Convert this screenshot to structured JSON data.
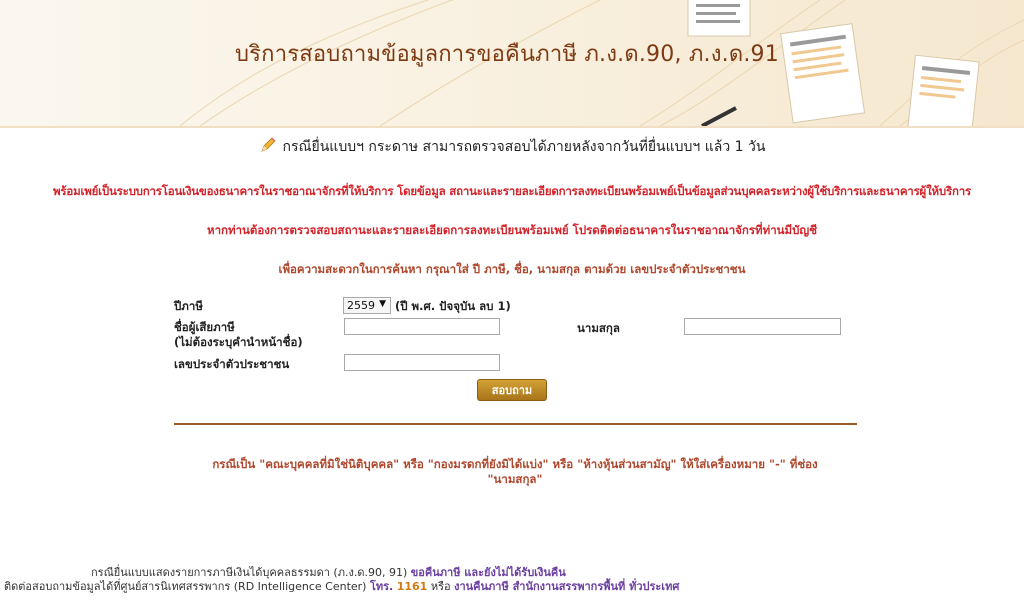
{
  "header": {
    "title": "บริการสอบถามข้อมูลการขอคืนภาษี ภ.ง.ด.90, ภ.ง.ด.91"
  },
  "notice": {
    "text": "กรณียื่นแบบฯ กระดาษ สามารถตรวจสอบได้ภายหลังจากวันที่ยื่นแบบฯ แล้ว 1 วัน"
  },
  "messages": {
    "promptpay_info": "พร้อมเพย์เป็นระบบการโอนเงินของธนาคารในราชอาณาจักรที่ให้บริการ โดยข้อมูล สถานะและรายละเอียดการลงทะเบียนพร้อมเพย์เป็นข้อมูลส่วนบุคคลระหว่างผู้ใช้บริการและธนาคารผู้ให้บริการ",
    "promptpay_contact": "หากท่านต้องการตรวจสอบสถานะและรายละเอียดการลงทะเบียนพร้อมเพย์ โปรดติดต่อธนาคารในราชอาณาจักรที่ท่านมีบัญชี",
    "search_hint": "เพื่อความสะดวกในการค้นหา กรุณาใส่ ปี ภาษี, ชื่อ, นามสกุล ตามด้วย เลขประจำตัวประชาชน"
  },
  "form": {
    "tax_year_label": "ปีภาษี",
    "tax_year_value": "2559",
    "tax_year_note": "(ปี พ.ศ. ปัจจุบัน ลบ 1)",
    "name_label_line1": "ชื่อผู้เสียภาษี",
    "name_label_line2": "(ไม่ต้องระบุคำนำหน้าชื่อ)",
    "name_value": "",
    "surname_label": "นามสกุล",
    "surname_value": "",
    "id_label": "เลขประจำตัวประชาชน",
    "id_value": "",
    "submit_label": "สอบถาม"
  },
  "note": {
    "text": "กรณีเป็น \"คณะบุคคลที่มิใช่นิติบุคคล\" หรือ \"กองมรดกที่ยังมิได้แบ่ง\" หรือ \"ห้างหุ้นส่วนสามัญ\" ให้ใส่เครื่องหมาย \"-\" ที่ช่อง \"นามสกุล\""
  },
  "footer": {
    "line1_text": "กรณียื่นแบบแสดงรายการภาษีเงินได้บุคคลธรรมดา (ภ.ง.ด.90, 91)",
    "line1_link": "ขอคืนภาษี และยังไม่ได้รับเงินคืน",
    "line2_text": "ติดต่อสอบถามข้อมูลได้ที่ศูนย์สารนิเทศสรรพากร (RD Intelligence Center)",
    "line2_phone_label": "โทร.",
    "line2_phone": "1161",
    "line2_or": "หรือ",
    "line2_link": "งานคืนภาษี สำนักงานสรรพากรพื้นที่ ทั่วประเทศ"
  },
  "colors": {
    "header_title": "#7d3a12",
    "red_text": "#d2232a",
    "brown_text": "#b0482d",
    "button": "#b8842a",
    "link_purple": "#6b3fa0",
    "phone_orange": "#d47a12"
  }
}
